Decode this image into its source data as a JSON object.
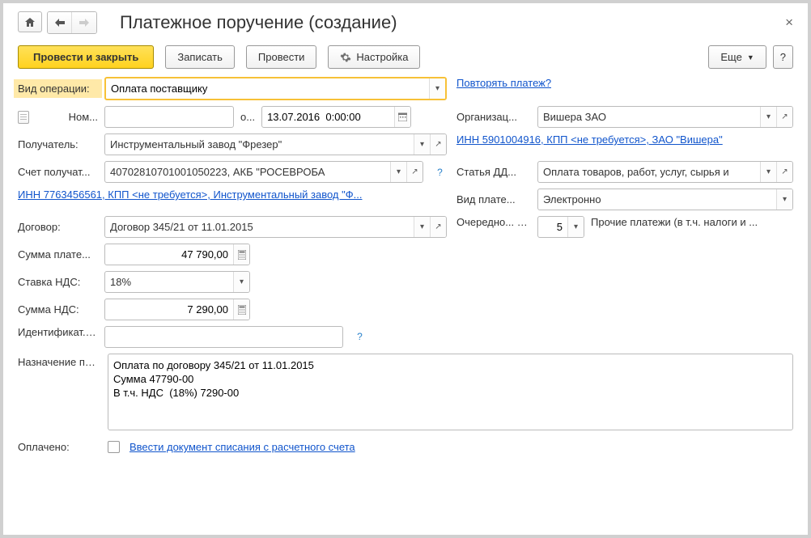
{
  "title": "Платежное поручение (создание)",
  "toolbar": {
    "post_close": "Провести и закрыть",
    "save": "Записать",
    "post": "Провести",
    "settings": "Настройка",
    "more": "Еще",
    "help": "?"
  },
  "labels": {
    "operation_type": "Вид операции:",
    "number": "Ном...",
    "from": "о...",
    "recipient": "Получатель:",
    "recipient_account": "Счет получат...",
    "contract": "Договор:",
    "payment_sum": "Сумма плате...",
    "vat_rate": "Ставка НДС:",
    "vat_sum": "Сумма НДС:",
    "payment_id": "Идентификат... платежа:",
    "purpose": "Назначение платежа:",
    "paid": "Оплачено:",
    "organization": "Организац...",
    "dds": "Статья ДД...",
    "payment_type": "Вид плате...",
    "priority": "Очередно... платежа:"
  },
  "values": {
    "operation_type": "Оплата поставщику",
    "number": "",
    "date": "13.07.2016  0:00:00",
    "recipient": "Инструментальный завод \"Фрезер\"",
    "recipient_account": "40702810701001050223, АКБ \"РОСЕВРОБА",
    "contract": "Договор 345/21 от 11.01.2015",
    "payment_sum": "47 790,00",
    "vat_rate": "18%",
    "vat_sum": "7 290,00",
    "payment_id": "",
    "purpose": "Оплата по договору 345/21 от 11.01.2015\nСумма 47790-00\nВ т.ч. НДС  (18%) 7290-00",
    "organization": "Вишера ЗАО",
    "dds": "Оплата товаров, работ, услуг, сырья и",
    "payment_type": "Электронно",
    "priority": "5",
    "priority_desc": "Прочие платежи (в т.ч. налоги и ..."
  },
  "links": {
    "repeat": "Повторять платеж?",
    "org_details": "ИНН 5901004916, КПП <не требуется>, ЗАО \"Вишера\"",
    "recipient_details": "ИНН 7763456561, КПП <не требуется>, Инструментальный завод \"Ф...",
    "paid_link": "Ввести документ списания с расчетного счета"
  }
}
